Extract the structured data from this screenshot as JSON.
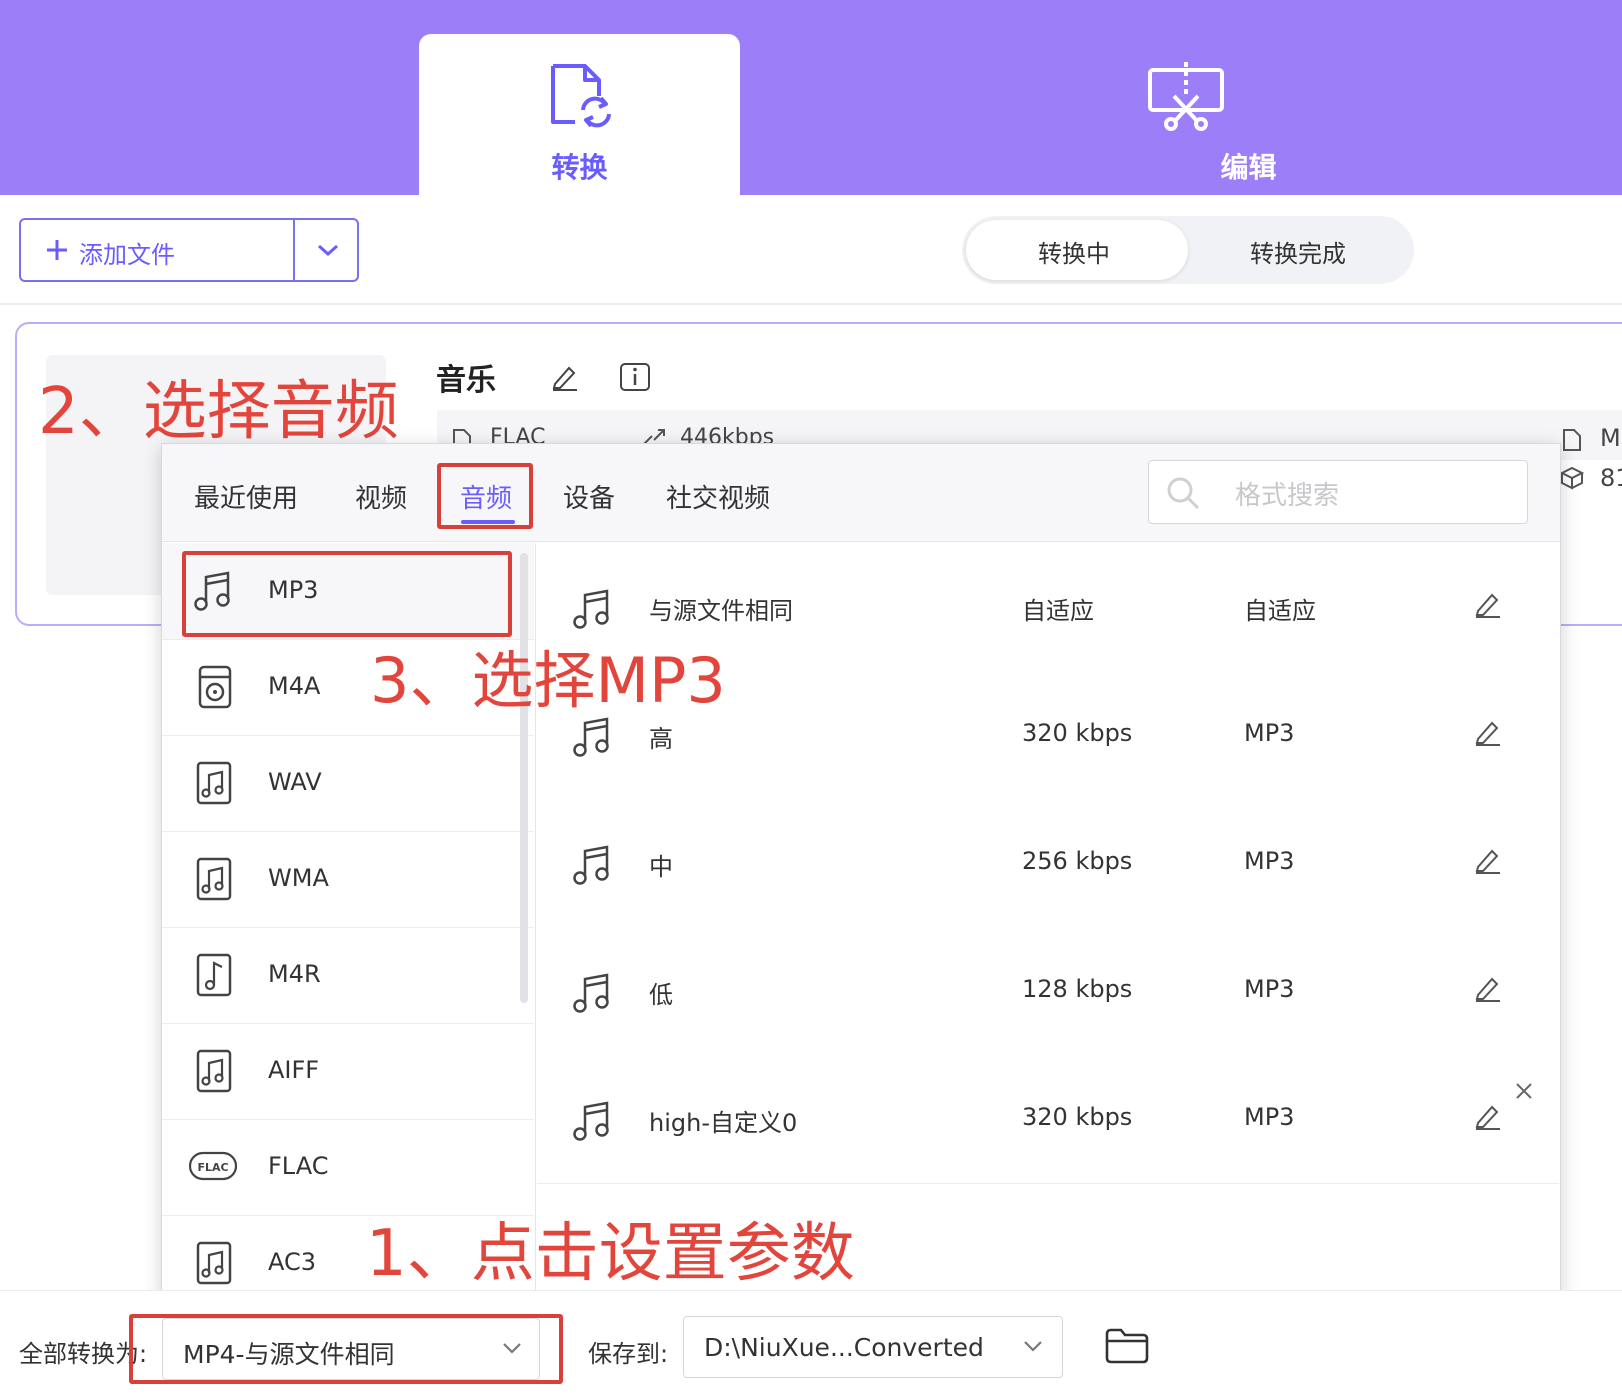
{
  "colors": {
    "header_bg": "#9c7ff8",
    "accent": "#6a5cff",
    "annotation_red": "#e2453c"
  },
  "header": {
    "tabs": [
      {
        "label": "转换",
        "icon": "file-convert-icon",
        "active": true
      },
      {
        "label": "编辑",
        "icon": "scissors-edit-icon",
        "active": false
      }
    ]
  },
  "toolbar": {
    "add_file_label": "添加文件",
    "segments": [
      "转换中",
      "转换完成"
    ],
    "active_segment": "转换中"
  },
  "file": {
    "title": "音乐",
    "source_format": "FLAC",
    "bitrate": "446kbps",
    "right_info_1": "M",
    "right_info_2": "81"
  },
  "annotations": {
    "step1": "1、点击设置参数",
    "step2": "2、选择音频",
    "step3": "3、选择MP3"
  },
  "format_panel": {
    "categories": [
      "最近使用",
      "视频",
      "音频",
      "设备",
      "社交视频"
    ],
    "active_category": "音频",
    "search_placeholder": "格式搜索",
    "formats": [
      "MP3",
      "M4A",
      "WAV",
      "WMA",
      "M4R",
      "AIFF",
      "FLAC",
      "AC3"
    ],
    "selected_format": "MP3",
    "presets": [
      {
        "name": "与源文件相同",
        "bitrate": "自适应",
        "format": "自适应"
      },
      {
        "name": "高",
        "bitrate": "320 kbps",
        "format": "MP3"
      },
      {
        "name": "中",
        "bitrate": "256 kbps",
        "format": "MP3"
      },
      {
        "name": "低",
        "bitrate": "128 kbps",
        "format": "MP3"
      },
      {
        "name": "high-自定义0",
        "bitrate": "320 kbps",
        "format": "MP3"
      }
    ]
  },
  "bottom_bar": {
    "convert_all_label": "全部转换为:",
    "convert_all_value": "MP4-与源文件相同",
    "save_to_label": "保存到:",
    "save_to_value": "D:\\NiuXue...Converted"
  }
}
